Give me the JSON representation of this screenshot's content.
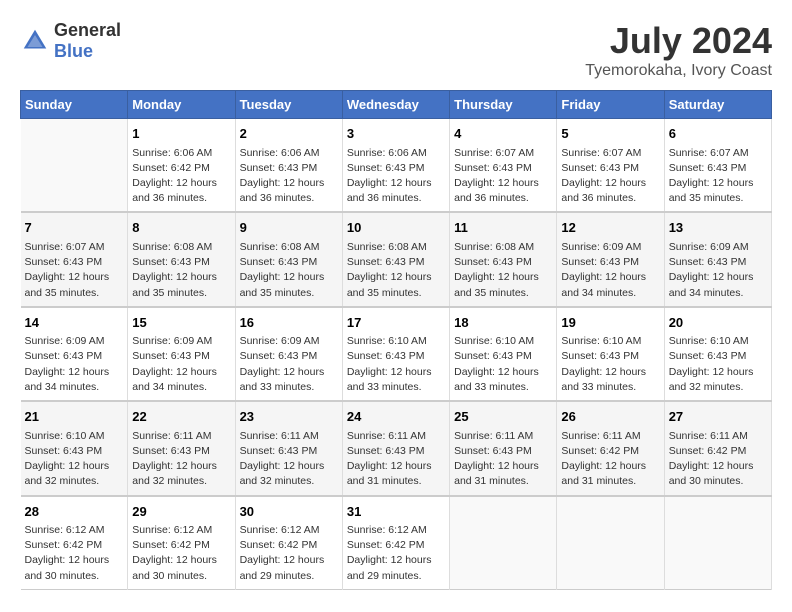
{
  "logo": {
    "general": "General",
    "blue": "Blue"
  },
  "title": "July 2024",
  "subtitle": "Tyemorokaha, Ivory Coast",
  "days_header": [
    "Sunday",
    "Monday",
    "Tuesday",
    "Wednesday",
    "Thursday",
    "Friday",
    "Saturday"
  ],
  "weeks": [
    [
      {
        "day": "",
        "sunrise": "",
        "sunset": "",
        "daylight": ""
      },
      {
        "day": "1",
        "sunrise": "Sunrise: 6:06 AM",
        "sunset": "Sunset: 6:42 PM",
        "daylight": "Daylight: 12 hours and 36 minutes."
      },
      {
        "day": "2",
        "sunrise": "Sunrise: 6:06 AM",
        "sunset": "Sunset: 6:43 PM",
        "daylight": "Daylight: 12 hours and 36 minutes."
      },
      {
        "day": "3",
        "sunrise": "Sunrise: 6:06 AM",
        "sunset": "Sunset: 6:43 PM",
        "daylight": "Daylight: 12 hours and 36 minutes."
      },
      {
        "day": "4",
        "sunrise": "Sunrise: 6:07 AM",
        "sunset": "Sunset: 6:43 PM",
        "daylight": "Daylight: 12 hours and 36 minutes."
      },
      {
        "day": "5",
        "sunrise": "Sunrise: 6:07 AM",
        "sunset": "Sunset: 6:43 PM",
        "daylight": "Daylight: 12 hours and 36 minutes."
      },
      {
        "day": "6",
        "sunrise": "Sunrise: 6:07 AM",
        "sunset": "Sunset: 6:43 PM",
        "daylight": "Daylight: 12 hours and 35 minutes."
      }
    ],
    [
      {
        "day": "7",
        "sunrise": "Sunrise: 6:07 AM",
        "sunset": "Sunset: 6:43 PM",
        "daylight": "Daylight: 12 hours and 35 minutes."
      },
      {
        "day": "8",
        "sunrise": "Sunrise: 6:08 AM",
        "sunset": "Sunset: 6:43 PM",
        "daylight": "Daylight: 12 hours and 35 minutes."
      },
      {
        "day": "9",
        "sunrise": "Sunrise: 6:08 AM",
        "sunset": "Sunset: 6:43 PM",
        "daylight": "Daylight: 12 hours and 35 minutes."
      },
      {
        "day": "10",
        "sunrise": "Sunrise: 6:08 AM",
        "sunset": "Sunset: 6:43 PM",
        "daylight": "Daylight: 12 hours and 35 minutes."
      },
      {
        "day": "11",
        "sunrise": "Sunrise: 6:08 AM",
        "sunset": "Sunset: 6:43 PM",
        "daylight": "Daylight: 12 hours and 35 minutes."
      },
      {
        "day": "12",
        "sunrise": "Sunrise: 6:09 AM",
        "sunset": "Sunset: 6:43 PM",
        "daylight": "Daylight: 12 hours and 34 minutes."
      },
      {
        "day": "13",
        "sunrise": "Sunrise: 6:09 AM",
        "sunset": "Sunset: 6:43 PM",
        "daylight": "Daylight: 12 hours and 34 minutes."
      }
    ],
    [
      {
        "day": "14",
        "sunrise": "Sunrise: 6:09 AM",
        "sunset": "Sunset: 6:43 PM",
        "daylight": "Daylight: 12 hours and 34 minutes."
      },
      {
        "day": "15",
        "sunrise": "Sunrise: 6:09 AM",
        "sunset": "Sunset: 6:43 PM",
        "daylight": "Daylight: 12 hours and 34 minutes."
      },
      {
        "day": "16",
        "sunrise": "Sunrise: 6:09 AM",
        "sunset": "Sunset: 6:43 PM",
        "daylight": "Daylight: 12 hours and 33 minutes."
      },
      {
        "day": "17",
        "sunrise": "Sunrise: 6:10 AM",
        "sunset": "Sunset: 6:43 PM",
        "daylight": "Daylight: 12 hours and 33 minutes."
      },
      {
        "day": "18",
        "sunrise": "Sunrise: 6:10 AM",
        "sunset": "Sunset: 6:43 PM",
        "daylight": "Daylight: 12 hours and 33 minutes."
      },
      {
        "day": "19",
        "sunrise": "Sunrise: 6:10 AM",
        "sunset": "Sunset: 6:43 PM",
        "daylight": "Daylight: 12 hours and 33 minutes."
      },
      {
        "day": "20",
        "sunrise": "Sunrise: 6:10 AM",
        "sunset": "Sunset: 6:43 PM",
        "daylight": "Daylight: 12 hours and 32 minutes."
      }
    ],
    [
      {
        "day": "21",
        "sunrise": "Sunrise: 6:10 AM",
        "sunset": "Sunset: 6:43 PM",
        "daylight": "Daylight: 12 hours and 32 minutes."
      },
      {
        "day": "22",
        "sunrise": "Sunrise: 6:11 AM",
        "sunset": "Sunset: 6:43 PM",
        "daylight": "Daylight: 12 hours and 32 minutes."
      },
      {
        "day": "23",
        "sunrise": "Sunrise: 6:11 AM",
        "sunset": "Sunset: 6:43 PM",
        "daylight": "Daylight: 12 hours and 32 minutes."
      },
      {
        "day": "24",
        "sunrise": "Sunrise: 6:11 AM",
        "sunset": "Sunset: 6:43 PM",
        "daylight": "Daylight: 12 hours and 31 minutes."
      },
      {
        "day": "25",
        "sunrise": "Sunrise: 6:11 AM",
        "sunset": "Sunset: 6:43 PM",
        "daylight": "Daylight: 12 hours and 31 minutes."
      },
      {
        "day": "26",
        "sunrise": "Sunrise: 6:11 AM",
        "sunset": "Sunset: 6:42 PM",
        "daylight": "Daylight: 12 hours and 31 minutes."
      },
      {
        "day": "27",
        "sunrise": "Sunrise: 6:11 AM",
        "sunset": "Sunset: 6:42 PM",
        "daylight": "Daylight: 12 hours and 30 minutes."
      }
    ],
    [
      {
        "day": "28",
        "sunrise": "Sunrise: 6:12 AM",
        "sunset": "Sunset: 6:42 PM",
        "daylight": "Daylight: 12 hours and 30 minutes."
      },
      {
        "day": "29",
        "sunrise": "Sunrise: 6:12 AM",
        "sunset": "Sunset: 6:42 PM",
        "daylight": "Daylight: 12 hours and 30 minutes."
      },
      {
        "day": "30",
        "sunrise": "Sunrise: 6:12 AM",
        "sunset": "Sunset: 6:42 PM",
        "daylight": "Daylight: 12 hours and 29 minutes."
      },
      {
        "day": "31",
        "sunrise": "Sunrise: 6:12 AM",
        "sunset": "Sunset: 6:42 PM",
        "daylight": "Daylight: 12 hours and 29 minutes."
      },
      {
        "day": "",
        "sunrise": "",
        "sunset": "",
        "daylight": ""
      },
      {
        "day": "",
        "sunrise": "",
        "sunset": "",
        "daylight": ""
      },
      {
        "day": "",
        "sunrise": "",
        "sunset": "",
        "daylight": ""
      }
    ]
  ]
}
